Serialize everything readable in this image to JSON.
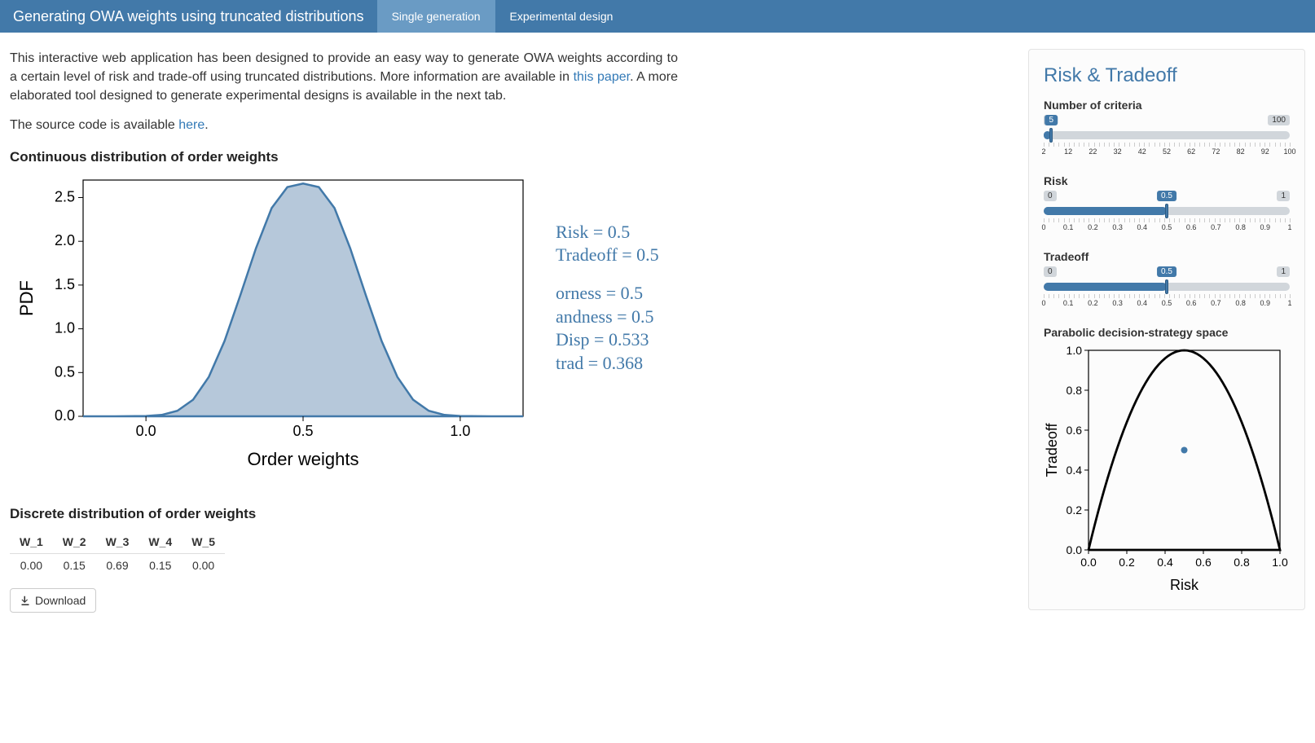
{
  "navbar": {
    "title": "Generating OWA weights using truncated distributions",
    "tabs": [
      {
        "label": "Single generation",
        "active": true
      },
      {
        "label": "Experimental design",
        "active": false
      }
    ]
  },
  "intro": {
    "p1a": "This interactive web application has been designed to provide an easy way to generate OWA weights according to a certain level of risk and trade-off using truncated distributions. More information are available in ",
    "p1_link": "this paper",
    "p1b": ". A more elaborated tool designed to generate experimental designs is available in the next tab.",
    "p2a": "The source code is available ",
    "p2_link": "here",
    "p2b": "."
  },
  "headings": {
    "continuous": "Continuous distribution of order weights",
    "discrete": "Discrete distribution of order weights",
    "sidebar_title": "Risk & Tradeoff",
    "parabolic": "Parabolic decision-strategy space"
  },
  "stats": {
    "risk": "Risk = 0.5",
    "tradeoff": "Tradeoff = 0.5",
    "orness": "orness = 0.5",
    "andness": "andness = 0.5",
    "disp": "Disp = 0.533",
    "trad": "trad = 0.368"
  },
  "chart_data": {
    "pdf": {
      "type": "area",
      "xlabel": "Order weights",
      "ylabel": "PDF",
      "xlim": [
        -0.2,
        1.2
      ],
      "ylim": [
        0.0,
        2.7
      ],
      "xticks": [
        0.0,
        0.5,
        1.0
      ],
      "yticks": [
        0.0,
        0.5,
        1.0,
        1.5,
        2.0,
        2.5
      ],
      "x": [
        -0.2,
        -0.1,
        0.0,
        0.05,
        0.1,
        0.15,
        0.2,
        0.25,
        0.3,
        0.35,
        0.4,
        0.45,
        0.5,
        0.55,
        0.6,
        0.65,
        0.7,
        0.75,
        0.8,
        0.85,
        0.9,
        0.95,
        1.0,
        1.1,
        1.2
      ],
      "y": [
        0.0,
        0.0,
        0.003,
        0.016,
        0.063,
        0.19,
        0.45,
        0.86,
        1.38,
        1.92,
        2.38,
        2.62,
        2.66,
        2.62,
        2.38,
        1.92,
        1.38,
        0.86,
        0.45,
        0.19,
        0.063,
        0.016,
        0.003,
        0.0,
        0.0
      ]
    },
    "parabolic": {
      "type": "scatter",
      "xlabel": "Risk",
      "ylabel": "Tradeoff",
      "xlim": [
        0.0,
        1.0
      ],
      "ylim": [
        0.0,
        1.0
      ],
      "xticks": [
        0.0,
        0.2,
        0.4,
        0.6,
        0.8,
        1.0
      ],
      "yticks": [
        0.0,
        0.2,
        0.4,
        0.6,
        0.8,
        1.0
      ],
      "point": {
        "x": 0.5,
        "y": 0.5
      },
      "boundary_note": "parabola y = 4x(1-x) truncated at y<=1"
    }
  },
  "weights_table": {
    "headers": [
      "W_1",
      "W_2",
      "W_3",
      "W_4",
      "W_5"
    ],
    "row": [
      "0.00",
      "0.15",
      "0.69",
      "0.15",
      "0.00"
    ]
  },
  "download_button": "Download",
  "sliders": {
    "criteria": {
      "label": "Number of criteria",
      "min": 2,
      "max": 100,
      "value": 5,
      "ticklabels": [
        "2",
        "12",
        "22",
        "32",
        "42",
        "52",
        "62",
        "72",
        "82",
        "92",
        "100"
      ]
    },
    "risk": {
      "label": "Risk",
      "min": 0,
      "max": 1,
      "value": 0.5,
      "ticklabels": [
        "0",
        "0.1",
        "0.2",
        "0.3",
        "0.4",
        "0.5",
        "0.6",
        "0.7",
        "0.8",
        "0.9",
        "1"
      ]
    },
    "tradeoff": {
      "label": "Tradeoff",
      "min": 0,
      "max": 1,
      "value": 0.5,
      "ticklabels": [
        "0",
        "0.1",
        "0.2",
        "0.3",
        "0.4",
        "0.5",
        "0.6",
        "0.7",
        "0.8",
        "0.9",
        "1"
      ]
    }
  }
}
